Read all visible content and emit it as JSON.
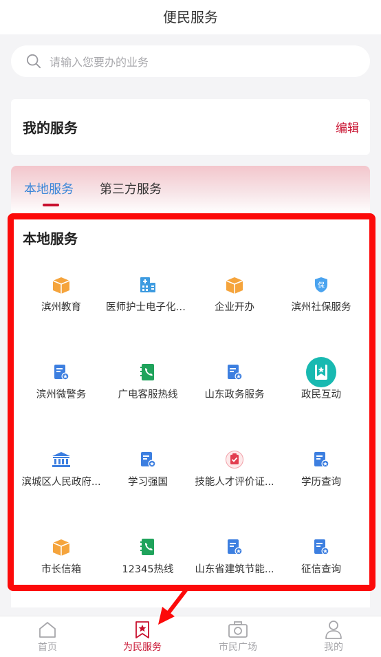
{
  "header": {
    "title": "便民服务"
  },
  "search": {
    "placeholder": "请输入您要办的业务"
  },
  "my_services": {
    "title": "我的服务",
    "edit_label": "编辑"
  },
  "tabs": [
    {
      "label": "本地服务",
      "active": true
    },
    {
      "label": "第三方服务",
      "active": false
    }
  ],
  "section": {
    "title": "本地服务"
  },
  "services": [
    {
      "label": "滨州教育",
      "icon": "box-icon"
    },
    {
      "label": "医师护士电子化注...",
      "icon": "hospital-icon"
    },
    {
      "label": "企业开办",
      "icon": "box-icon"
    },
    {
      "label": "滨州社保服务",
      "icon": "shield-insurance-icon"
    },
    {
      "label": "滨州微警务",
      "icon": "document-badge-icon"
    },
    {
      "label": "广电客服热线",
      "icon": "phone-book-icon"
    },
    {
      "label": "山东政务服务",
      "icon": "document-badge-icon"
    },
    {
      "label": "政民互动",
      "icon": "bookmark-star-icon"
    },
    {
      "label": "滨城区人民政府...",
      "icon": "government-building-icon"
    },
    {
      "label": "学习强国",
      "icon": "document-badge-icon"
    },
    {
      "label": "技能人才评价证...",
      "icon": "certificate-check-icon"
    },
    {
      "label": "学历查询",
      "icon": "document-badge-icon"
    },
    {
      "label": "市长信箱",
      "icon": "box-icon"
    },
    {
      "label": "12345热线",
      "icon": "phone-book-icon"
    },
    {
      "label": "山东省建筑节能...",
      "icon": "document-badge-icon"
    },
    {
      "label": "征信查询",
      "icon": "document-badge-icon"
    }
  ],
  "tabbar": [
    {
      "label": "首页",
      "icon": "home-icon",
      "active": false
    },
    {
      "label": "为民服务",
      "icon": "bookmark-star-icon",
      "active": true
    },
    {
      "label": "市民广场",
      "icon": "camera-icon",
      "active": false
    },
    {
      "label": "我的",
      "icon": "user-icon",
      "active": false
    }
  ],
  "colors": {
    "accent": "#c8102e",
    "tab_active": "#3a86d8",
    "highlight": "#fc0a0a",
    "icon_orange": "#f5a43c",
    "icon_blue": "#3d7fe0",
    "icon_green": "#1fa35b"
  }
}
